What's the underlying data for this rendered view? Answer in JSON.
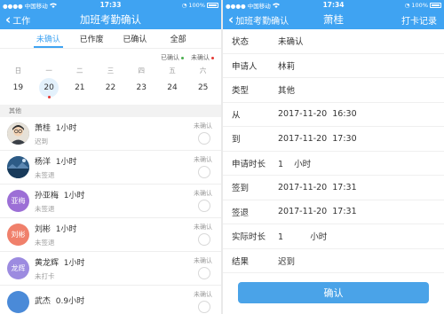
{
  "left": {
    "status": {
      "carrier": "中国移动",
      "time": "17:33",
      "battery": "100%"
    },
    "nav": {
      "back_label": "工作",
      "title": "加班考勤确认"
    },
    "tabs": [
      "未确认",
      "已作废",
      "已确认",
      "全部"
    ],
    "active_tab": 0,
    "legend": {
      "confirmed": "已确认",
      "unconfirmed": "未确认",
      "confirmed_color": "#4caf50",
      "unconfirmed_color": "#e53935"
    },
    "weekdays": [
      "日",
      "一",
      "二",
      "三",
      "四",
      "五",
      "六"
    ],
    "dates": [
      "19",
      "20",
      "21",
      "22",
      "23",
      "24",
      "25"
    ],
    "selected_date_index": 1,
    "group_label": "其他",
    "records": [
      {
        "name": "萧桂",
        "duration": "1小时",
        "result": "迟到",
        "status": "未确认",
        "avatar_text": "",
        "avatar_color": "#5b6470",
        "avatar_icon": "cartoon-avatar-icon"
      },
      {
        "name": "杨洋",
        "duration": "1小时",
        "result": "未签退",
        "status": "未确认",
        "avatar_text": "",
        "avatar_color": "#3b6f9e",
        "avatar_icon": "landscape-avatar-icon"
      },
      {
        "name": "孙亚梅",
        "duration": "1小时",
        "result": "未签退",
        "status": "未确认",
        "avatar_text": "亚梅",
        "avatar_color": "#9c6fd6"
      },
      {
        "name": "刘彬",
        "duration": "1小时",
        "result": "未签退",
        "status": "未确认",
        "avatar_text": "刘彬",
        "avatar_color": "#f0806b"
      },
      {
        "name": "黄龙辉",
        "duration": "1小时",
        "result": "未打卡",
        "status": "未确认",
        "avatar_text": "龙辉",
        "avatar_color": "#9c8be0"
      },
      {
        "name": "武杰",
        "duration": "0.9小时",
        "result": "",
        "status": "未确认",
        "avatar_text": "",
        "avatar_color": "#4a8ad8"
      }
    ]
  },
  "right": {
    "status": {
      "carrier": "中国移动",
      "time": "17:34",
      "battery": "100%"
    },
    "nav": {
      "back_label": "加班考勤确认",
      "title": "萧桂",
      "right_label": "打卡记录"
    },
    "details": [
      {
        "label": "状态",
        "value": "未确认"
      },
      {
        "label": "申请人",
        "value": "林莉"
      },
      {
        "label": "类型",
        "value": "其他"
      },
      {
        "label": "从",
        "value": "2017-11-20  16:30"
      },
      {
        "label": "到",
        "value": "2017-11-20  17:30"
      },
      {
        "label": "申请时长",
        "value": "1    小时"
      },
      {
        "label": "签到",
        "value": "2017-11-20  17:31"
      },
      {
        "label": "签退",
        "value": "2017-11-20  17:31"
      },
      {
        "label": "实际时长",
        "value": "1          小时"
      },
      {
        "label": "结果",
        "value": "迟到"
      }
    ],
    "confirm_label": "确认",
    "accent_color": "#3fa3f2"
  }
}
